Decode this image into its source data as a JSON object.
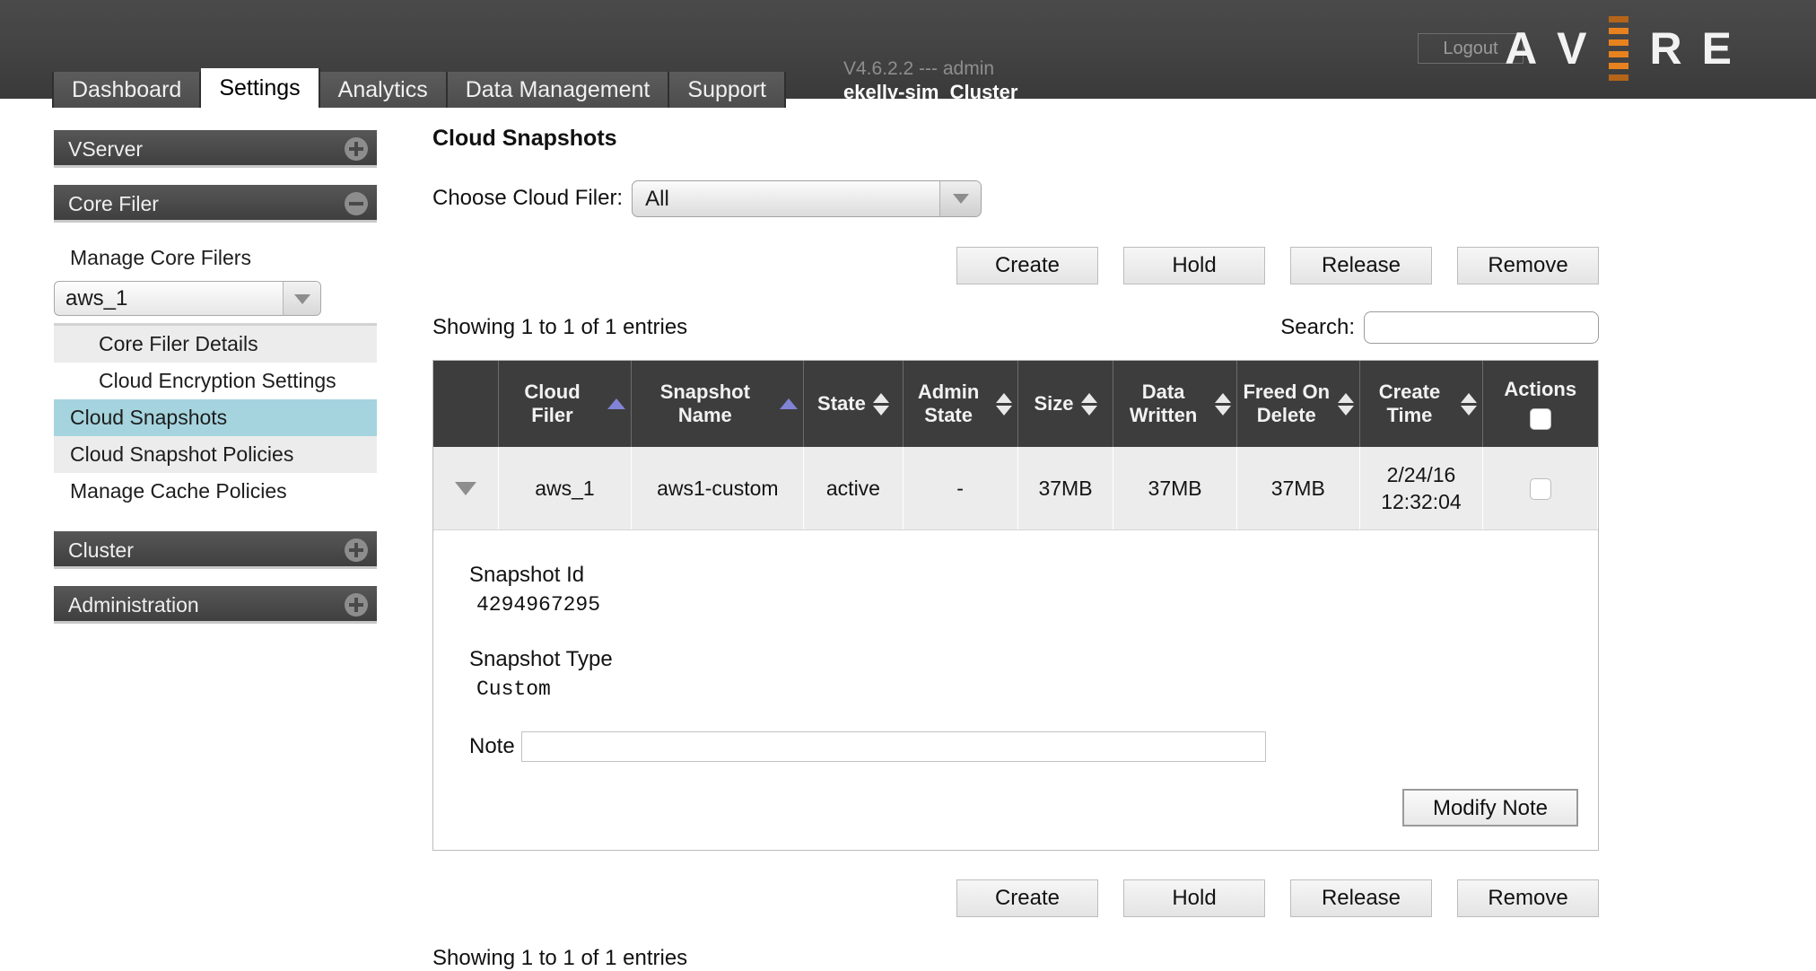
{
  "header": {
    "logout_label": "Logout",
    "version_line": "V4.6.2.2 --- admin",
    "cluster_name": "ekelly-sim_Cluster",
    "brand": {
      "letters": [
        "A",
        "V",
        "R",
        "E"
      ],
      "accent_color": "#e8821e"
    },
    "tabs": [
      {
        "label": "Dashboard",
        "active": false
      },
      {
        "label": "Settings",
        "active": true
      },
      {
        "label": "Analytics",
        "active": false
      },
      {
        "label": "Data Management",
        "active": false
      },
      {
        "label": "Support",
        "active": false
      }
    ]
  },
  "sidebar": {
    "sections": [
      {
        "label": "VServer",
        "icon": "plus-circle-icon"
      },
      {
        "label": "Core Filer",
        "icon": "minus-circle-icon"
      },
      {
        "label": "Cluster",
        "icon": "plus-circle-icon"
      },
      {
        "label": "Administration",
        "icon": "plus-circle-icon"
      }
    ],
    "core_filer_links": [
      {
        "label": "Manage Core Filers"
      },
      {
        "label": "Core Filer Details"
      },
      {
        "label": "Cloud Encryption Settings"
      },
      {
        "label": "Cloud Snapshots"
      },
      {
        "label": "Cloud Snapshot Policies"
      },
      {
        "label": "Manage Cache Policies"
      }
    ],
    "core_filer_select": {
      "value": "aws_1"
    },
    "selected_link": "Cloud Snapshots",
    "highlight_color": "#a5d4de"
  },
  "main": {
    "page_title": "Cloud Snapshots",
    "filter": {
      "label": "Choose Cloud Filer:",
      "value": "All"
    },
    "action_buttons": [
      "Create",
      "Hold",
      "Release",
      "Remove"
    ],
    "entries_text_top": "Showing 1 to 1 of 1 entries",
    "entries_text_bottom": "Showing 1 to 1 of 1 entries",
    "search": {
      "label": "Search:",
      "value": "",
      "placeholder": ""
    },
    "table": {
      "columns": [
        {
          "label": "",
          "sort": "none"
        },
        {
          "label": "Cloud Filer",
          "sort": "asc-active"
        },
        {
          "label": "Snapshot Name",
          "sort": "asc-active"
        },
        {
          "label": "State",
          "sort": "both"
        },
        {
          "label": "Admin State",
          "sort": "both"
        },
        {
          "label": "Size",
          "sort": "both"
        },
        {
          "label": "Data Written",
          "sort": "both"
        },
        {
          "label": "Freed On Delete",
          "sort": "both"
        },
        {
          "label": "Create Time",
          "sort": "both"
        },
        {
          "label": "Actions",
          "sort": "checkbox"
        }
      ],
      "rows": [
        {
          "expander": "triangle-down-icon",
          "cloud_filer": "aws_1",
          "snapshot_name": "aws1-custom",
          "state": "active",
          "admin_state": "-",
          "size": "37MB",
          "data_written": "37MB",
          "freed_on_delete": "37MB",
          "create_time_date": "2/24/16",
          "create_time_clock": "12:32:04",
          "action_checked": false
        }
      ]
    },
    "detail": {
      "snapshot_id_label": "Snapshot Id",
      "snapshot_id_value": "4294967295",
      "snapshot_type_label": "Snapshot Type",
      "snapshot_type_value": "Custom",
      "note_label": "Note",
      "note_value": "",
      "modify_note_label": "Modify Note"
    }
  }
}
